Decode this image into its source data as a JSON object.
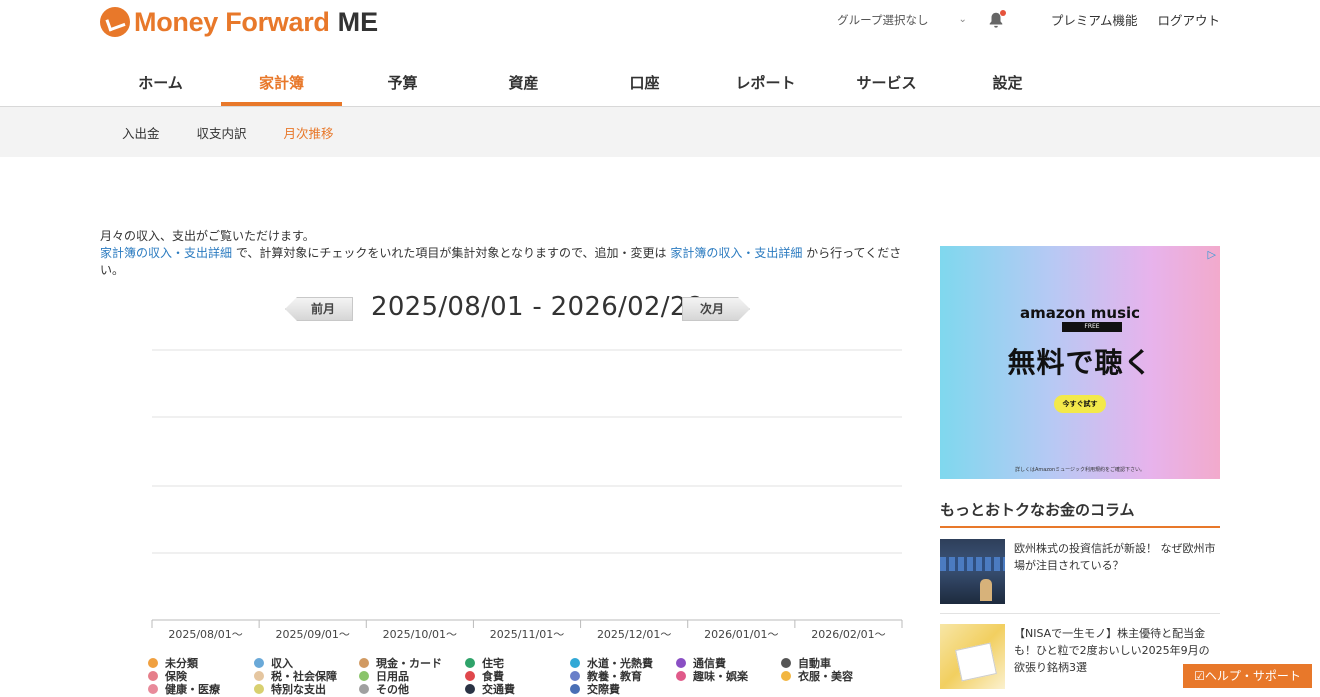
{
  "brand": {
    "name": "Money Forward",
    "suffix": "ME"
  },
  "header": {
    "group_select": "グループ選択なし",
    "premium": "プレミアム機能",
    "logout": "ログアウト"
  },
  "main_nav": [
    {
      "label": "ホーム",
      "active": false
    },
    {
      "label": "家計簿",
      "active": true
    },
    {
      "label": "予算",
      "active": false
    },
    {
      "label": "資産",
      "active": false
    },
    {
      "label": "口座",
      "active": false
    },
    {
      "label": "レポート",
      "active": false
    },
    {
      "label": "サービス",
      "active": false
    },
    {
      "label": "設定",
      "active": false
    }
  ],
  "sub_nav": [
    {
      "label": "入出金",
      "active": false
    },
    {
      "label": "収支内訳",
      "active": false
    },
    {
      "label": "月次推移",
      "active": true
    }
  ],
  "intro": {
    "line1": "月々の収入、支出がご覧いただけます。",
    "link1": "家計簿の収入・支出詳細",
    "mid": " で、計算対象にチェックをいれた項目が集計対象となりますので、追加・変更は ",
    "link2": "家計簿の収入・支出詳細",
    "end": " から行ってください。"
  },
  "range": {
    "prev_label": "前月",
    "next_label": "次月",
    "text": "2025/08/01 - 2026/02/28"
  },
  "chart_data": {
    "type": "bar",
    "categories": [
      "2025/08/01〜",
      "2025/09/01〜",
      "2025/10/01〜",
      "2025/11/01〜",
      "2025/12/01〜",
      "2026/01/01〜",
      "2026/02/01〜"
    ],
    "grid": true,
    "legend_position": "bottom",
    "series": [
      {
        "name": "未分類",
        "color": "#f0a040"
      },
      {
        "name": "収入",
        "color": "#6aa9d8"
      },
      {
        "name": "現金・カード",
        "color": "#d19a62"
      },
      {
        "name": "住宅",
        "color": "#2fa36a"
      },
      {
        "name": "水道・光熱費",
        "color": "#31a8d6"
      },
      {
        "name": "通信費",
        "color": "#8a4fc4"
      },
      {
        "name": "自動車",
        "color": "#555555"
      },
      {
        "name": "保険",
        "color": "#e67e8a"
      },
      {
        "name": "税・社会保障",
        "color": "#e5c6a0"
      },
      {
        "name": "日用品",
        "color": "#8ac46a"
      },
      {
        "name": "食費",
        "color": "#e0474c"
      },
      {
        "name": "教養・教育",
        "color": "#6a7fc9"
      },
      {
        "name": "趣味・娯楽",
        "color": "#e05a8a"
      },
      {
        "name": "衣服・美容",
        "color": "#f2b640"
      },
      {
        "name": "健康・医療",
        "color": "#e88a9a"
      },
      {
        "name": "特別な支出",
        "color": "#d8d070"
      },
      {
        "name": "その他",
        "color": "#a0a0a0"
      },
      {
        "name": "交通費",
        "color": "#2b3344"
      },
      {
        "name": "交際費",
        "color": "#4a6fb5"
      }
    ]
  },
  "ad": {
    "brand": "amazon music",
    "free": "FREE",
    "headline": "無料で聴く",
    "button": "今すぐ試す",
    "fine": "詳しくはAmazonミュージック利用規約をご確認下さい。"
  },
  "column": {
    "title": "もっとおトクなお金のコラム",
    "articles": [
      {
        "title": "欧州株式の投資信託が新設！ なぜ欧州市場が注目されている？"
      },
      {
        "title": "【NISAで一生モノ】株主優待と配当金も！ひと粒で2度おいしい2025年9月の欲張り銘柄3選"
      }
    ]
  },
  "help": "ヘルプ・サポート"
}
